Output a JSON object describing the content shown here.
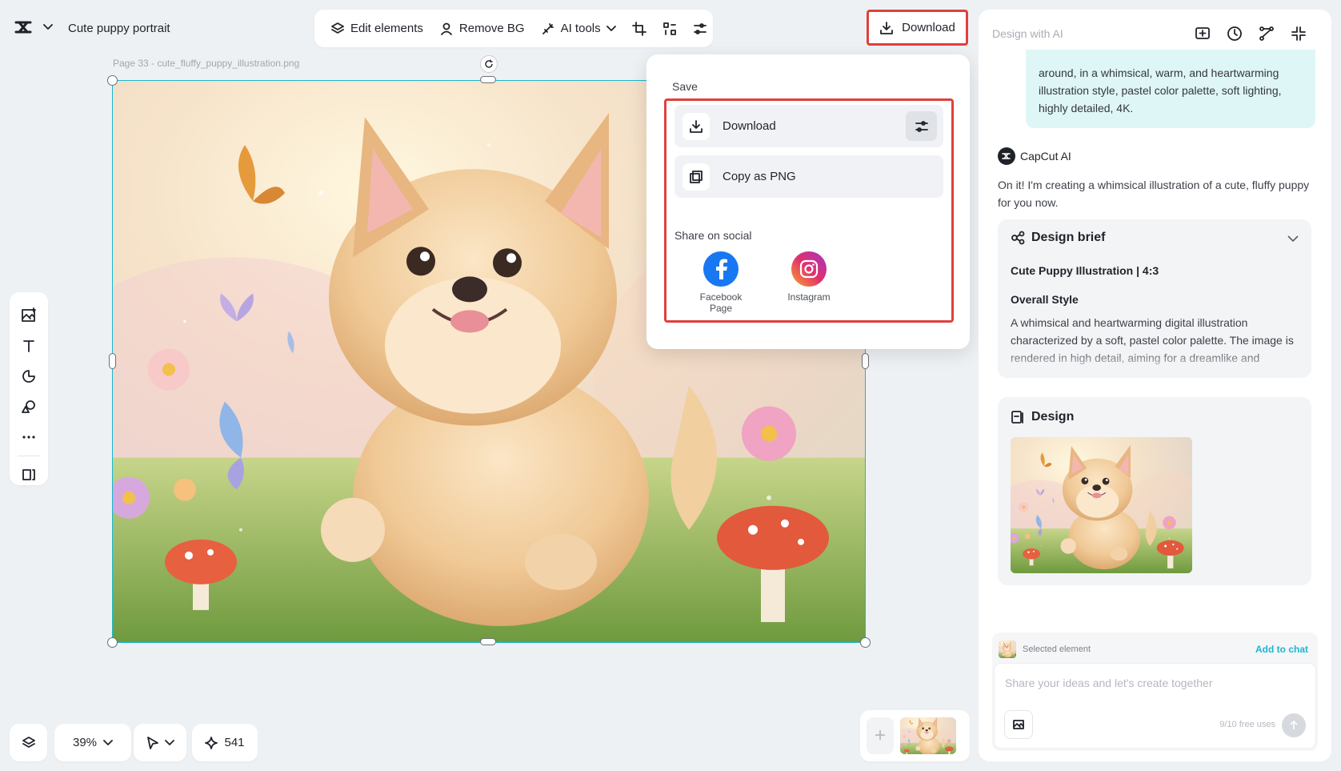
{
  "header": {
    "project_title": "Cute puppy portrait"
  },
  "toolbar": {
    "edit_elements": "Edit elements",
    "remove_bg": "Remove BG",
    "ai_tools": "AI tools",
    "icons": [
      "crop-icon",
      "transform-icon",
      "adjust-icon"
    ]
  },
  "download_button": {
    "label": "Download"
  },
  "canvas": {
    "page_label": "Page 33 -  cute_fluffy_puppy_illustration.png",
    "selection_color": "#17b8d1"
  },
  "left_tools": [
    "add-image-icon",
    "text-icon",
    "shapes-icon",
    "elements-icon",
    "more-icon",
    "resize-icon"
  ],
  "bottom_bar": {
    "zoom": "39%",
    "credits": "541"
  },
  "dropdown": {
    "save_label": "Save",
    "download_label": "Download",
    "copy_label": "Copy as PNG",
    "share_label": "Share on social",
    "facebook_label": "Facebook Page",
    "instagram_label": "Instagram",
    "highlight_color": "#e0403c"
  },
  "right_panel": {
    "title": "Design with AI",
    "user_message": "around, in a whimsical, warm, and heartwarming illustration style, pastel color palette, soft lighting, highly detailed, 4K.",
    "ai_name": "CapCut AI",
    "ai_message": "On it! I'm creating a whimsical illustration of a cute, fluffy puppy for you now.",
    "brief": {
      "title": "Design brief",
      "subtitle": "Cute Puppy Illustration | 4:3",
      "style_label": "Overall Style",
      "style_desc": "A whimsical and heartwarming digital illustration characterized by a soft, pastel color palette. The image is rendered in high detail, aiming for a dreamlike and"
    },
    "design": {
      "title": "Design"
    },
    "chat": {
      "selected_label": "Selected element",
      "add_to_chat": "Add to chat",
      "placeholder": "Share your ideas and let's create together",
      "free_uses": "9/10 free uses"
    }
  }
}
